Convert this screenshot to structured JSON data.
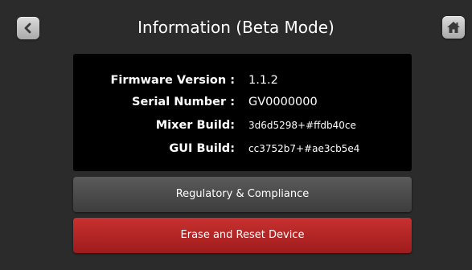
{
  "header": {
    "title": "Information (Beta Mode)",
    "back_icon": "chevron-left-icon",
    "home_icon": "home-icon"
  },
  "info": [
    {
      "label": "Firmware Version :",
      "value": "1.1.2"
    },
    {
      "label": "Serial Number :",
      "value": "GV0000000"
    },
    {
      "label": "Mixer Build:",
      "value": "3d6d5298+#ffdb40ce"
    },
    {
      "label": "GUI Build:",
      "value": "cc3752b7+#ae3cb5e4"
    }
  ],
  "buttons": {
    "regulatory_label": "Regulatory & Compliance",
    "erase_label": "Erase and Reset Device"
  },
  "colors": {
    "background": "#2b2b2b",
    "panel": "#000000",
    "regulatory_button": "#4a4a4a",
    "erase_button": "#b52424",
    "text": "#ffffff"
  }
}
